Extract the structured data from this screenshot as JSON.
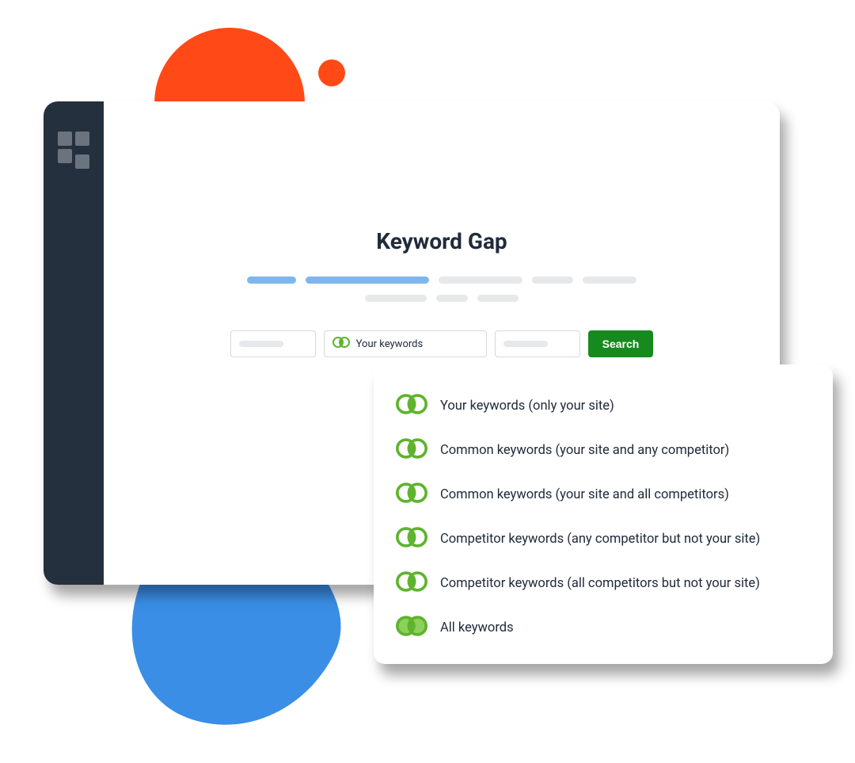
{
  "page": {
    "title": "Keyword Gap"
  },
  "search": {
    "selected_filter_label": "Your keywords",
    "button_label": "Search"
  },
  "options": [
    {
      "label": "Your keywords (only your site)"
    },
    {
      "label": "Common keywords (your site and any competitor)"
    },
    {
      "label": "Common keywords (your site and all competitors)"
    },
    {
      "label": "Competitor keywords (any competitor but not your site)"
    },
    {
      "label": "Competitor keywords (all competitors but not your site)"
    },
    {
      "label": "All keywords"
    }
  ],
  "colors": {
    "accent_green": "#178a1f",
    "venn_green": "#5fb32e",
    "sidebar_bg": "#25303e",
    "pill_blue": "#7fb6ef",
    "orange": "#ff4a17",
    "blue": "#3a8ee6"
  }
}
